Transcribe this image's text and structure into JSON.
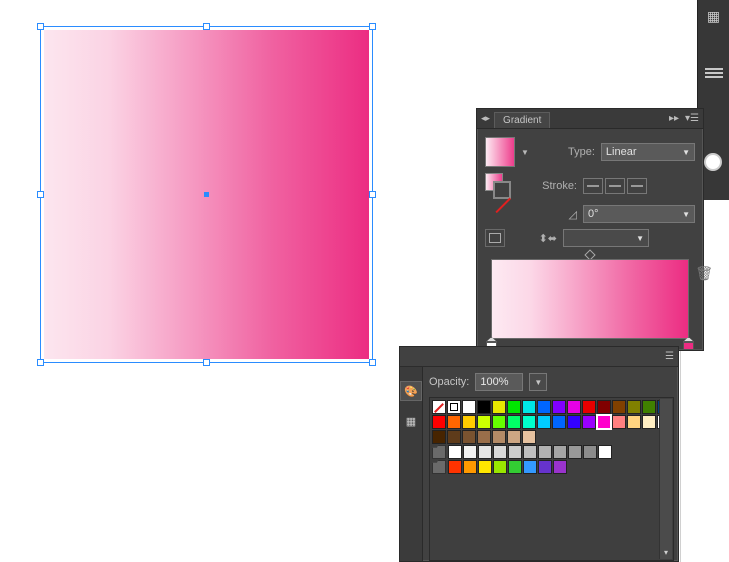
{
  "canvas": {
    "shape": "rectangle",
    "selected": true,
    "fill": {
      "type": "linear",
      "angle": 0,
      "from": "#fce6ef",
      "to": "#ec2d82"
    }
  },
  "gradient_panel": {
    "title": "Gradient",
    "type_label": "Type:",
    "type_value": "Linear",
    "stroke_label": "Stroke:",
    "angle_icon": "angle",
    "angle_value": "0°",
    "aspect_value": "",
    "stops": [
      {
        "position": 0,
        "color": "#ffffff",
        "opacity": 100
      },
      {
        "position": 100,
        "color": "#ec2c82",
        "opacity": 100
      }
    ]
  },
  "swatch_panel": {
    "opacity_label": "Opacity:",
    "opacity_value": "100%",
    "rows": [
      [
        "none",
        "reg",
        "#ffffff",
        "#000000",
        "#e6e600",
        "#00e600",
        "#00e6e6",
        "#0066ff",
        "#8000ff",
        "#e600e6",
        "#e60000",
        "#800000",
        "#804000",
        "#808000",
        "#408000",
        "#004080"
      ],
      [
        "#ff0000",
        "#ff6600",
        "#ffcc00",
        "#ccff00",
        "#66ff00",
        "#00ff66",
        "#00ffcc",
        "#00ccff",
        "#0066ff",
        "#3300ff",
        "#9900ff",
        "#ff00cc",
        "#ff8080",
        "#ffd480",
        "#ffeec2",
        "#ffffff"
      ],
      [
        "#472400",
        "#5e3b1a",
        "#7a5330",
        "#996e4a",
        "#b38a66",
        "#cda683",
        "#e6c2a0"
      ],
      [
        "folder",
        "#ffffff",
        "#f2f2f2",
        "#e5e5e5",
        "#d8d8d8",
        "#cccccc",
        "#bfbfbf",
        "#b2b2b2",
        "#a5a5a5",
        "#999999",
        "#8c8c8c",
        "#ffffff"
      ],
      [
        "folder",
        "#ff3300",
        "#ff9900",
        "#ffe600",
        "#99e600",
        "#33cc33",
        "#3399ff",
        "#6633cc",
        "#9933cc"
      ]
    ],
    "selected": {
      "row": 1,
      "col": 11
    }
  },
  "dock": {
    "icons": [
      "grid",
      "ring",
      "menu",
      "circle"
    ]
  }
}
